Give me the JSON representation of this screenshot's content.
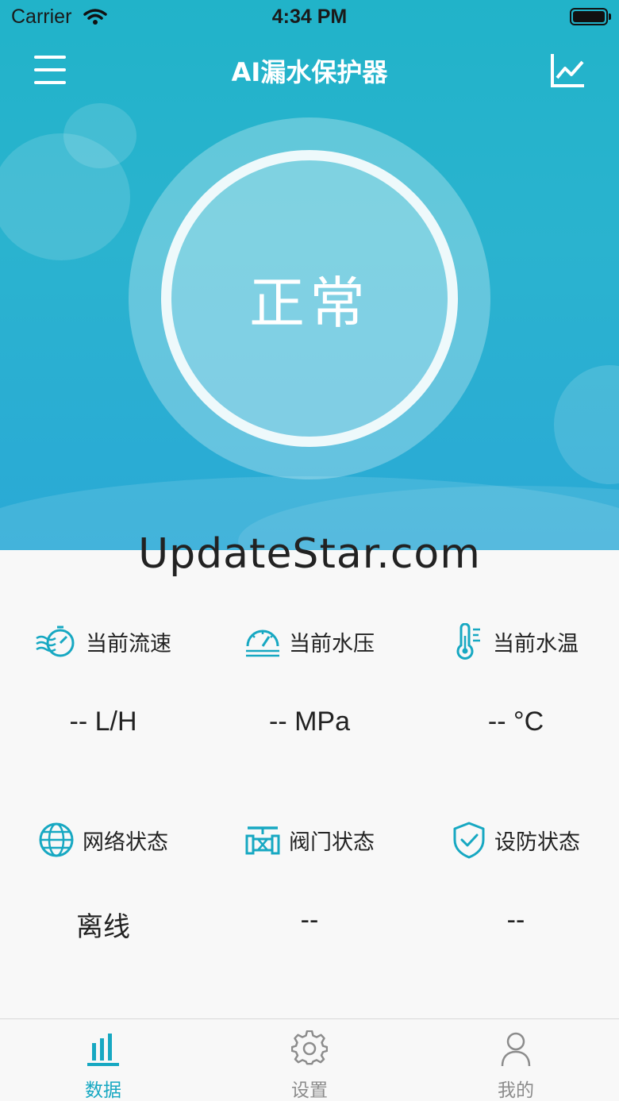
{
  "status_bar": {
    "carrier": "Carrier",
    "time": "4:34 PM"
  },
  "nav": {
    "title": "AI漏水保护器",
    "menu_icon": "menu-icon",
    "chart_icon": "line-chart-icon"
  },
  "hero": {
    "status": "正常"
  },
  "watermark": "UpdateStar.com",
  "metrics": [
    {
      "icon": "flow-speed-icon",
      "label": "当前流速",
      "value": "-- L/H"
    },
    {
      "icon": "pressure-gauge-icon",
      "label": "当前水压",
      "value": "-- MPa"
    },
    {
      "icon": "thermometer-icon",
      "label": "当前水温",
      "value": "-- °C"
    },
    {
      "icon": "globe-icon",
      "label": "网络状态",
      "value": "离线"
    },
    {
      "icon": "valve-icon",
      "label": "阀门状态",
      "value": "--"
    },
    {
      "icon": "shield-check-icon",
      "label": "设防状态",
      "value": "--"
    }
  ],
  "tabs": [
    {
      "icon": "bar-chart-icon",
      "label": "数据",
      "active": true
    },
    {
      "icon": "gear-icon",
      "label": "设置",
      "active": false
    },
    {
      "icon": "user-icon",
      "label": "我的",
      "active": false
    }
  ],
  "colors": {
    "accent": "#17a8c2",
    "hero_top": "#21b3c9",
    "hero_bottom": "#2aa9d6"
  }
}
